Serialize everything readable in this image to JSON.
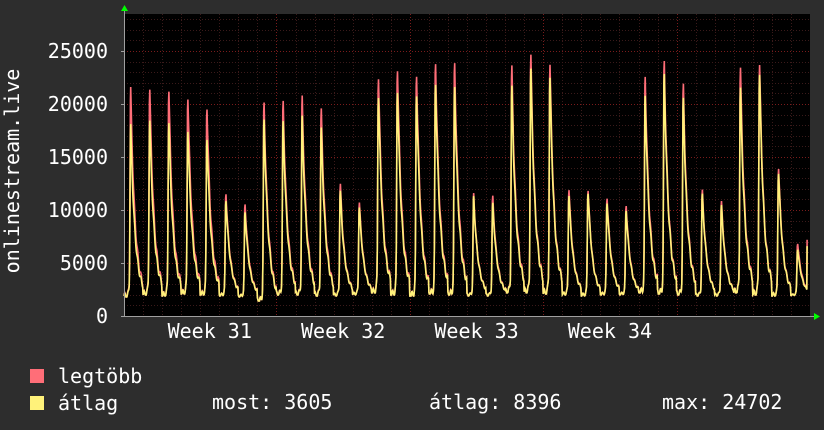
{
  "colors": {
    "background": "#2d2d2d",
    "plot_background": "#000000",
    "max_series": "#ff6e78",
    "avg_series": "#fff27a",
    "grid_major": "#7a1b1b",
    "grid_minor": "#3a1a1a",
    "axis": "#a0a0a0",
    "arrow": "#00ff00",
    "text": "#ffffff"
  },
  "chart_data": {
    "type": "line",
    "ylabel": "onlinestream.live",
    "ylim": [
      0,
      28500
    ],
    "yticks": [
      0,
      5000,
      10000,
      15000,
      20000,
      25000
    ],
    "ytick_labels": [
      "0",
      "5000",
      "10000",
      "15000",
      "20000",
      "25000"
    ],
    "xlim": [
      0,
      36
    ],
    "xtick_labels": [
      {
        "label": "Week 31",
        "at": 4.5
      },
      {
        "label": "Week 32",
        "at": 11.5
      },
      {
        "label": "Week 33",
        "at": 18.5
      },
      {
        "label": "Week 34",
        "at": 25.5
      }
    ],
    "week_boundaries": [
      8,
      15,
      22,
      29
    ],
    "daily_points": {
      "x": [
        0,
        1,
        2,
        3,
        4,
        5,
        6,
        7,
        8,
        9,
        10,
        11,
        12,
        13,
        14,
        15,
        16,
        17,
        18,
        19,
        20,
        21,
        22,
        23,
        24,
        25,
        26,
        27,
        28,
        29,
        30,
        31,
        32,
        33,
        34,
        35
      ],
      "max": [
        22700,
        22600,
        22600,
        21900,
        20900,
        12200,
        11100,
        21200,
        21200,
        21700,
        20500,
        13100,
        11300,
        23900,
        24800,
        24200,
        25300,
        25200,
        12100,
        11800,
        24700,
        25900,
        25100,
        12600,
        12600,
        11800,
        11000,
        23900,
        25300,
        22900,
        12400,
        11300,
        24700,
        25200,
        14800,
        7200
      ],
      "avg": [
        19000,
        19500,
        19400,
        18600,
        17800,
        11500,
        10300,
        19500,
        19200,
        19700,
        18600,
        12400,
        10800,
        22000,
        22600,
        22200,
        23200,
        22800,
        11800,
        11100,
        22700,
        24500,
        23800,
        12000,
        12300,
        11300,
        10500,
        22000,
        24000,
        21500,
        12000,
        10900,
        22700,
        24200,
        14300,
        6600
      ],
      "min": [
        1900,
        2100,
        2000,
        2200,
        2100,
        2000,
        1900,
        1500,
        2100,
        2100,
        2000,
        2000,
        2100,
        2300,
        2100,
        2000,
        2200,
        2100,
        2000,
        2000,
        2300,
        2300,
        2200,
        2100,
        2000,
        2100,
        2100,
        2300,
        2200,
        2100,
        2000,
        2000,
        2300,
        2100,
        2000,
        2000
      ]
    },
    "series": [
      {
        "name": "legtöbb",
        "color": "#ff6e78"
      },
      {
        "name": "átlag",
        "color": "#fff27a"
      }
    ]
  },
  "legend": [
    {
      "label": "legtöbb",
      "color": "#ff6e78"
    },
    {
      "label": "átlag",
      "color": "#fff27a"
    }
  ],
  "stats": {
    "now": "most: 3605",
    "avg": "átlag: 8396",
    "max": "max: 24702"
  }
}
